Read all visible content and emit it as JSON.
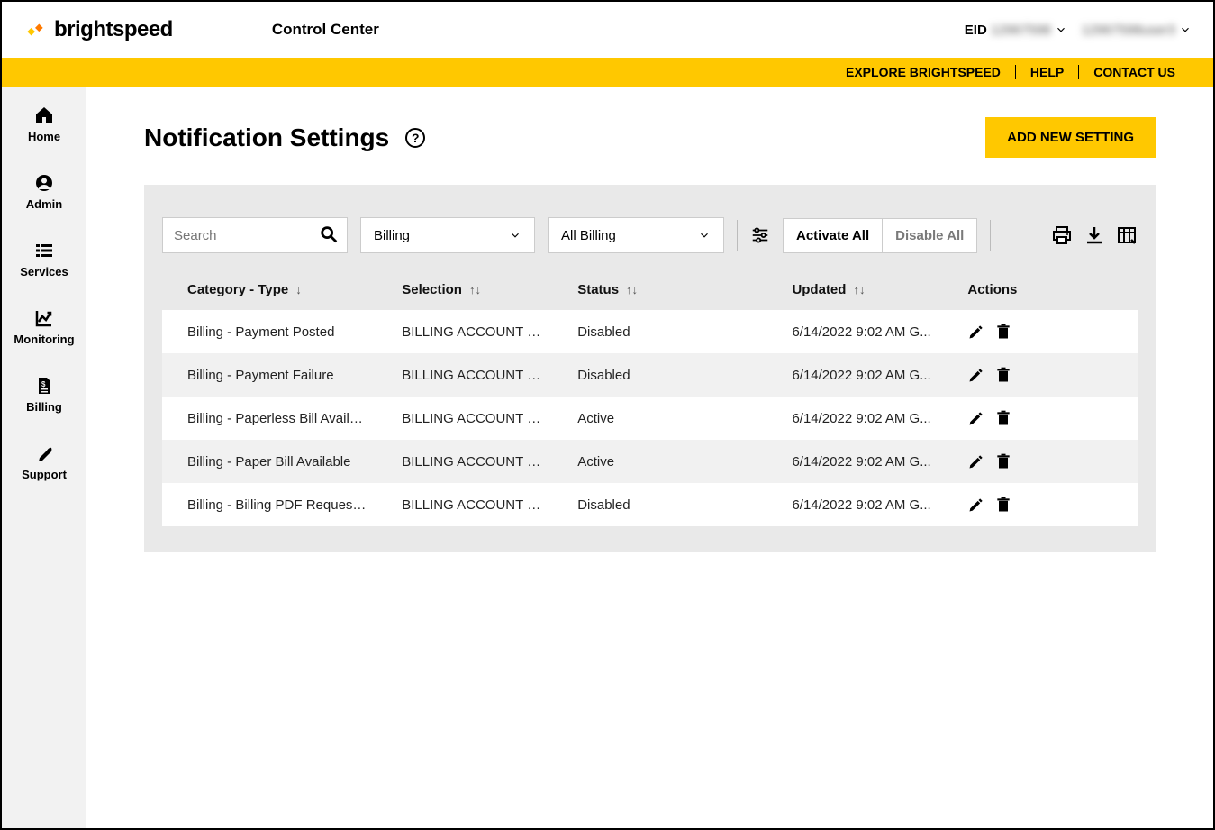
{
  "header": {
    "brand": "brightspeed",
    "app_title": "Control Center",
    "eid_label": "EID",
    "eid_value": "12967598",
    "user_value": "12967598user3"
  },
  "topnav": {
    "explore": "EXPLORE BRIGHTSPEED",
    "help": "HELP",
    "contact": "CONTACT US"
  },
  "sidebar": {
    "home": "Home",
    "admin": "Admin",
    "services": "Services",
    "monitoring": "Monitoring",
    "billing": "Billing",
    "support": "Support"
  },
  "page": {
    "title": "Notification Settings",
    "help": "?",
    "add_button": "ADD NEW SETTING"
  },
  "toolbar": {
    "search_placeholder": "Search",
    "category_value": "Billing",
    "type_value": "All Billing",
    "activate_all": "Activate All",
    "disable_all": "Disable All"
  },
  "table": {
    "columns": {
      "category_type": "Category - Type",
      "selection": "Selection",
      "status": "Status",
      "updated": "Updated",
      "actions": "Actions"
    },
    "sort_icons": {
      "down": "↓",
      "both": "↑↓"
    },
    "rows": [
      {
        "category_type": "Billing - Payment Posted",
        "selection": "BILLING ACCOUNT N...",
        "status": "Disabled",
        "updated": "6/14/2022 9:02 AM G..."
      },
      {
        "category_type": "Billing - Payment Failure",
        "selection": "BILLING ACCOUNT N...",
        "status": "Disabled",
        "updated": "6/14/2022 9:02 AM G..."
      },
      {
        "category_type": "Billing - Paperless Bill Available",
        "selection": "BILLING ACCOUNT N...",
        "status": "Active",
        "updated": "6/14/2022 9:02 AM G..."
      },
      {
        "category_type": "Billing - Paper Bill Available",
        "selection": "BILLING ACCOUNT N...",
        "status": "Active",
        "updated": "6/14/2022 9:02 AM G..."
      },
      {
        "category_type": "Billing - Billing PDF Request A...",
        "selection": "BILLING ACCOUNT N...",
        "status": "Disabled",
        "updated": "6/14/2022 9:02 AM G..."
      }
    ]
  }
}
